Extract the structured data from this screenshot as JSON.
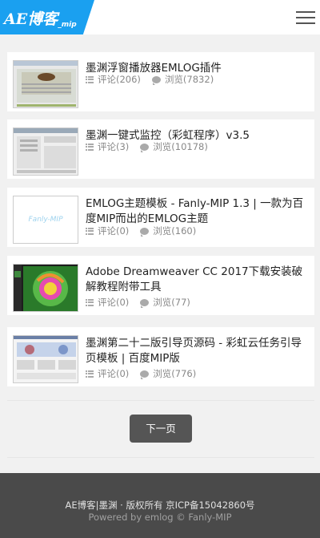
{
  "header": {
    "logo_text": "AE博客",
    "logo_sub": "_mip",
    "menu_icon": "hamburger-menu-icon",
    "accent_color": "#1aa0f0"
  },
  "articles": [
    {
      "title": "墨渊浮窗播放器EMLOG插件",
      "comments": "评论(206)",
      "views": "浏览(7832)"
    },
    {
      "title": "墨渊一键式监控（彩虹程序）v3.5",
      "comments": "评论(3)",
      "views": "浏览(10178)"
    },
    {
      "title": "EMLOG主题模板 - Fanly-MIP 1.3 | 一款为百度MIP而出的EMLOG主题",
      "comments": "评论(0)",
      "views": "浏览(160)",
      "thumb_text": "Fanly-MIP"
    },
    {
      "title": "Adobe Dreamweaver CC 2017下载安装破解教程附带工具",
      "comments": "评论(0)",
      "views": "浏览(77)"
    },
    {
      "title": "墨渊第二十二版引导页源码 - 彩虹云任务引导页模板 | 百度MIP版",
      "comments": "评论(0)",
      "views": "浏览(776)"
    }
  ],
  "pagination": {
    "next_label": "下一页"
  },
  "footer": {
    "site_link": "AE博客|墨渊",
    "rights": "· 版权所有",
    "icp": "京ICP备15042860号",
    "powered_prefix": "Powered by",
    "emlog_link": "emlog",
    "copyright_sep": "©",
    "theme_link": "Fanly-MIP"
  }
}
